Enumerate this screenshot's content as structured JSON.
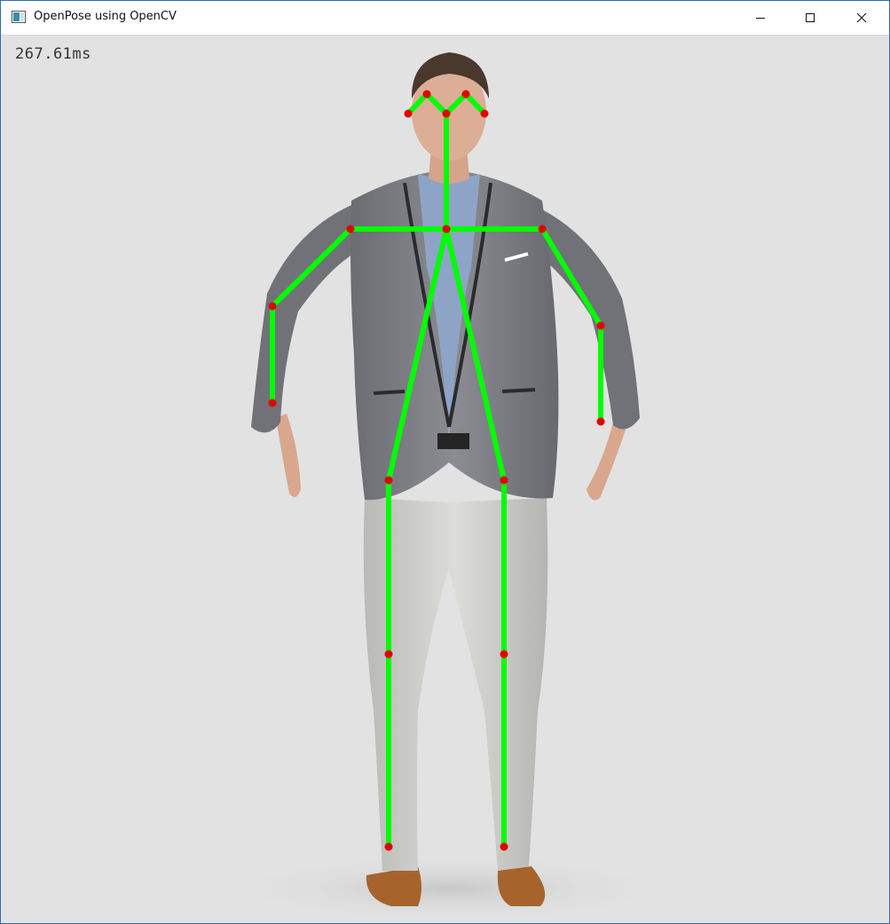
{
  "window": {
    "title": "OpenPose using OpenCV",
    "icon": "opencv-window-icon",
    "controls": {
      "minimize_icon": "minimize-icon",
      "maximize_icon": "maximize-icon",
      "close_icon": "close-icon"
    }
  },
  "overlay": {
    "inference_time": "267.61ms",
    "skeleton_color": "#00ff00",
    "keypoint_color": "#e00000"
  }
}
